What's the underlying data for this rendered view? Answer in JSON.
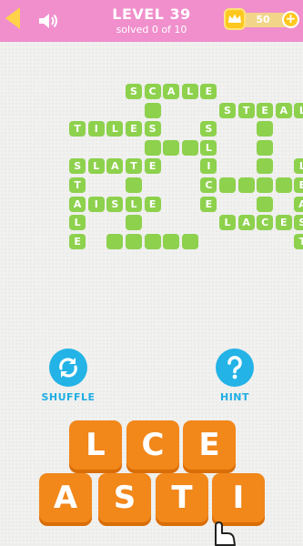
{
  "header": {
    "level": "LEVEL 39",
    "progress_text": "solved 0 of 10",
    "coins": "50",
    "back_icon": "back-arrow-icon",
    "sound_icon": "speaker-icon",
    "coin_icon": "crown-icon",
    "add_coins": "+"
  },
  "colors": {
    "header_bg": "#f08fcc",
    "cell": "#8dd14d",
    "tile": "#f2871a",
    "action": "#23b3e6",
    "coin": "#ffc81e"
  },
  "board": {
    "cells": [
      {
        "r": 0,
        "c": 5,
        "l": "S"
      },
      {
        "r": 0,
        "c": 6,
        "l": "C"
      },
      {
        "r": 0,
        "c": 7,
        "l": "A"
      },
      {
        "r": 0,
        "c": 8,
        "l": "L"
      },
      {
        "r": 0,
        "c": 9,
        "l": "E"
      },
      {
        "r": 1,
        "c": 6,
        "l": ""
      },
      {
        "r": 1,
        "c": 10,
        "l": "S"
      },
      {
        "r": 1,
        "c": 11,
        "l": "T"
      },
      {
        "r": 1,
        "c": 12,
        "l": "E"
      },
      {
        "r": 1,
        "c": 13,
        "l": "A"
      },
      {
        "r": 1,
        "c": 14,
        "l": "L"
      },
      {
        "r": 2,
        "c": 2,
        "l": "T"
      },
      {
        "r": 2,
        "c": 3,
        "l": "I"
      },
      {
        "r": 2,
        "c": 4,
        "l": "L"
      },
      {
        "r": 2,
        "c": 5,
        "l": "E"
      },
      {
        "r": 2,
        "c": 6,
        "l": "S"
      },
      {
        "r": 2,
        "c": 9,
        "l": "S"
      },
      {
        "r": 2,
        "c": 12,
        "l": ""
      },
      {
        "r": 3,
        "c": 6,
        "l": ""
      },
      {
        "r": 3,
        "c": 7,
        "l": ""
      },
      {
        "r": 3,
        "c": 8,
        "l": ""
      },
      {
        "r": 3,
        "c": 9,
        "l": "L"
      },
      {
        "r": 3,
        "c": 12,
        "l": ""
      },
      {
        "r": 4,
        "c": 2,
        "l": "S"
      },
      {
        "r": 4,
        "c": 3,
        "l": "L"
      },
      {
        "r": 4,
        "c": 4,
        "l": "A"
      },
      {
        "r": 4,
        "c": 5,
        "l": "T"
      },
      {
        "r": 4,
        "c": 6,
        "l": "E"
      },
      {
        "r": 4,
        "c": 9,
        "l": "I"
      },
      {
        "r": 4,
        "c": 12,
        "l": ""
      },
      {
        "r": 4,
        "c": 14,
        "l": "L"
      },
      {
        "r": 5,
        "c": 2,
        "l": "T"
      },
      {
        "r": 5,
        "c": 5,
        "l": ""
      },
      {
        "r": 5,
        "c": 9,
        "l": "C"
      },
      {
        "r": 5,
        "c": 10,
        "l": ""
      },
      {
        "r": 5,
        "c": 11,
        "l": ""
      },
      {
        "r": 5,
        "c": 12,
        "l": ""
      },
      {
        "r": 5,
        "c": 13,
        "l": ""
      },
      {
        "r": 5,
        "c": 14,
        "l": "E"
      },
      {
        "r": 6,
        "c": 2,
        "l": "A"
      },
      {
        "r": 6,
        "c": 3,
        "l": "I"
      },
      {
        "r": 6,
        "c": 4,
        "l": "S"
      },
      {
        "r": 6,
        "c": 5,
        "l": "L"
      },
      {
        "r": 6,
        "c": 6,
        "l": "E"
      },
      {
        "r": 6,
        "c": 9,
        "l": "E"
      },
      {
        "r": 6,
        "c": 12,
        "l": ""
      },
      {
        "r": 6,
        "c": 14,
        "l": "A"
      },
      {
        "r": 7,
        "c": 2,
        "l": "L"
      },
      {
        "r": 7,
        "c": 5,
        "l": ""
      },
      {
        "r": 7,
        "c": 10,
        "l": "L"
      },
      {
        "r": 7,
        "c": 11,
        "l": "A"
      },
      {
        "r": 7,
        "c": 12,
        "l": "C"
      },
      {
        "r": 7,
        "c": 13,
        "l": "E"
      },
      {
        "r": 7,
        "c": 14,
        "l": "S"
      },
      {
        "r": 8,
        "c": 2,
        "l": "E"
      },
      {
        "r": 8,
        "c": 4,
        "l": ""
      },
      {
        "r": 8,
        "c": 5,
        "l": ""
      },
      {
        "r": 8,
        "c": 6,
        "l": ""
      },
      {
        "r": 8,
        "c": 7,
        "l": ""
      },
      {
        "r": 8,
        "c": 8,
        "l": ""
      },
      {
        "r": 8,
        "c": 14,
        "l": "T"
      }
    ]
  },
  "actions": {
    "shuffle": {
      "label": "SHUFFLE",
      "icon": "shuffle-icon"
    },
    "hint": {
      "label": "HINT",
      "icon": "question-icon"
    }
  },
  "letters": {
    "row1": [
      "L",
      "C",
      "E"
    ],
    "row2": [
      "A",
      "S",
      "T",
      "I"
    ]
  },
  "pointer_icon": "hand-pointer-icon"
}
